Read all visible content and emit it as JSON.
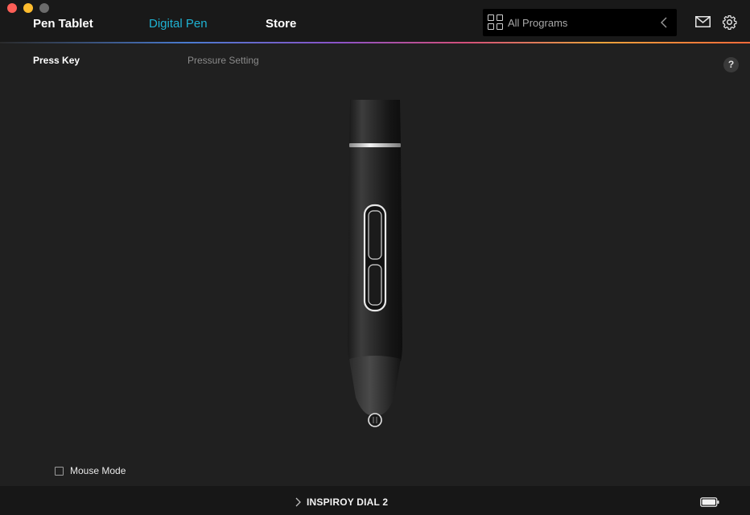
{
  "nav": {
    "tabs": [
      {
        "label": "Pen Tablet",
        "active": false
      },
      {
        "label": "Digital Pen",
        "active": true
      },
      {
        "label": "Store",
        "active": false
      }
    ],
    "program_selector": {
      "label": "All Programs",
      "icon": "grid-icon"
    },
    "icons": [
      "mail-icon",
      "gear-icon"
    ]
  },
  "subtabs": {
    "press_key": "Press Key",
    "pressure_setting": "Pressure Setting",
    "active": "Press Key"
  },
  "help": {
    "label": "?"
  },
  "options": {
    "mouse_mode_label": "Mouse Mode",
    "mouse_mode_checked": false
  },
  "footer": {
    "device_name": "INSPIROY DIAL 2",
    "battery_icon": "battery-icon"
  },
  "colors": {
    "accent": "#1fb3d3",
    "background": "#202020",
    "bar_background": "#191919"
  }
}
